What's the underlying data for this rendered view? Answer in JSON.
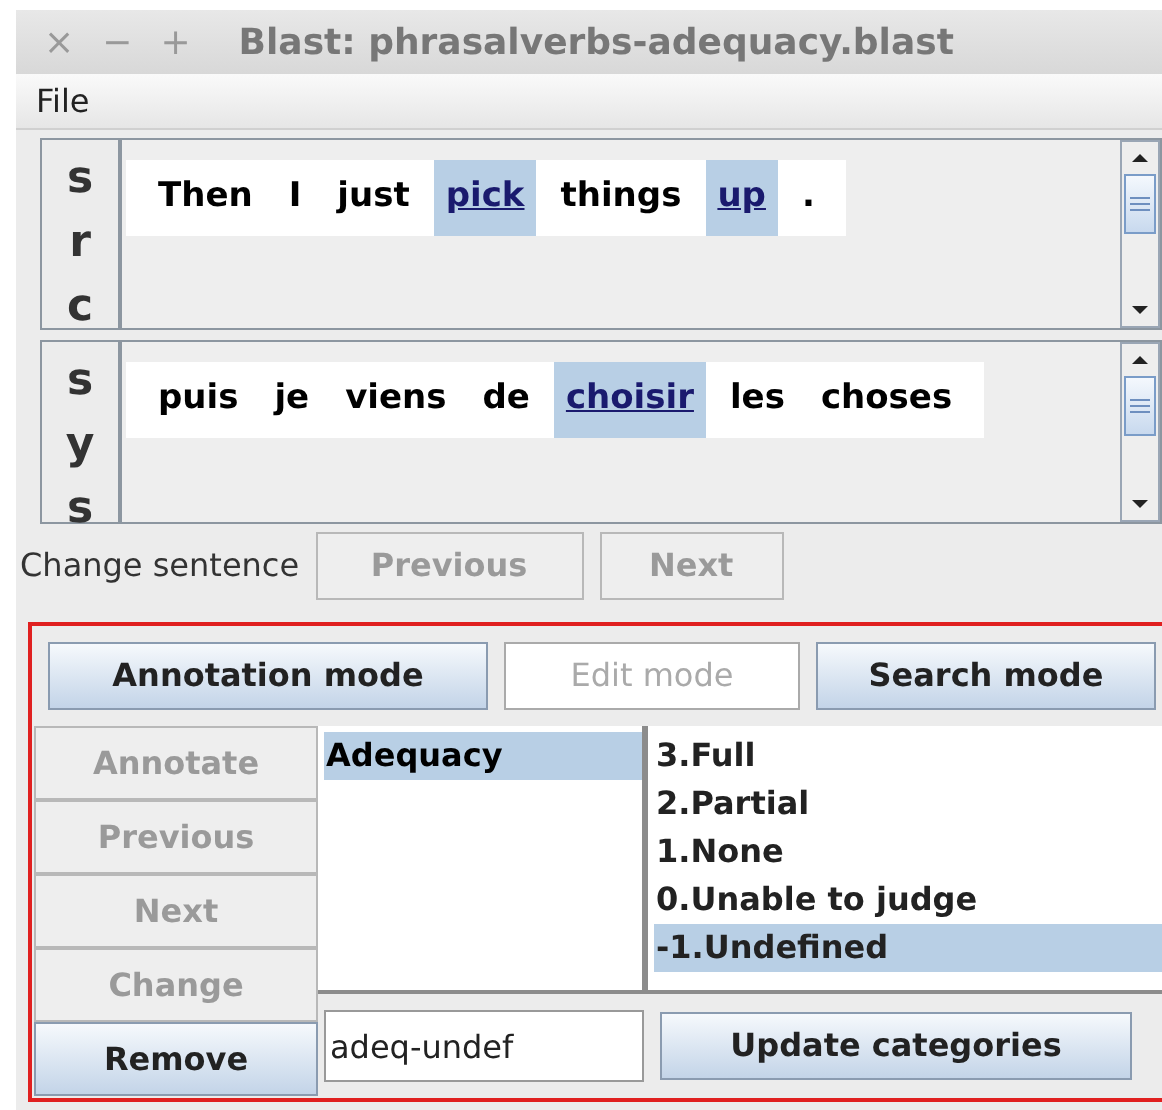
{
  "window": {
    "title": "Blast: phrasalverbs-adequacy.blast",
    "controls": [
      "×",
      "−",
      "+"
    ]
  },
  "menu": [
    "File"
  ],
  "source": {
    "label": "src",
    "tokens": [
      {
        "text": "Then",
        "highlighted": false
      },
      {
        "text": "I",
        "highlighted": false
      },
      {
        "text": "just",
        "highlighted": false
      },
      {
        "text": "pick",
        "highlighted": true
      },
      {
        "text": "things",
        "highlighted": false
      },
      {
        "text": "up",
        "highlighted": true
      },
      {
        "text": ".",
        "highlighted": false
      }
    ]
  },
  "system": {
    "label": "sys",
    "tokens": [
      {
        "text": "puis",
        "highlighted": false
      },
      {
        "text": "je",
        "highlighted": false
      },
      {
        "text": "viens",
        "highlighted": false
      },
      {
        "text": "de",
        "highlighted": false
      },
      {
        "text": "choisir",
        "highlighted": true
      },
      {
        "text": "les",
        "highlighted": false
      },
      {
        "text": "choses",
        "highlighted": false
      }
    ]
  },
  "change_sentence": {
    "label": "Change sentence",
    "buttons": [
      {
        "label": "Previous",
        "disabled": true
      },
      {
        "label": "Next",
        "disabled": true
      }
    ]
  },
  "modes": [
    {
      "label": "Annotation mode",
      "disabled": false
    },
    {
      "label": "Edit mode",
      "disabled": true
    },
    {
      "label": "Search mode",
      "disabled": false
    }
  ],
  "actions": [
    {
      "label": "Annotate",
      "disabled": true
    },
    {
      "label": "Previous",
      "disabled": true
    },
    {
      "label": "Next",
      "disabled": true
    },
    {
      "label": "Change",
      "disabled": true
    },
    {
      "label": "Remove",
      "disabled": false
    }
  ],
  "error_types": [
    {
      "label": "Adequacy",
      "selected": true
    }
  ],
  "categories": [
    {
      "label": "3.Full",
      "selected": false
    },
    {
      "label": "2.Partial",
      "selected": false
    },
    {
      "label": "1.None",
      "selected": false
    },
    {
      "label": "0.Unable to judge",
      "selected": false
    },
    {
      "label": "-1.Undefined",
      "selected": true
    }
  ],
  "category_field": {
    "value": "adeq-undef"
  },
  "update_button": {
    "label": "Update categories"
  }
}
